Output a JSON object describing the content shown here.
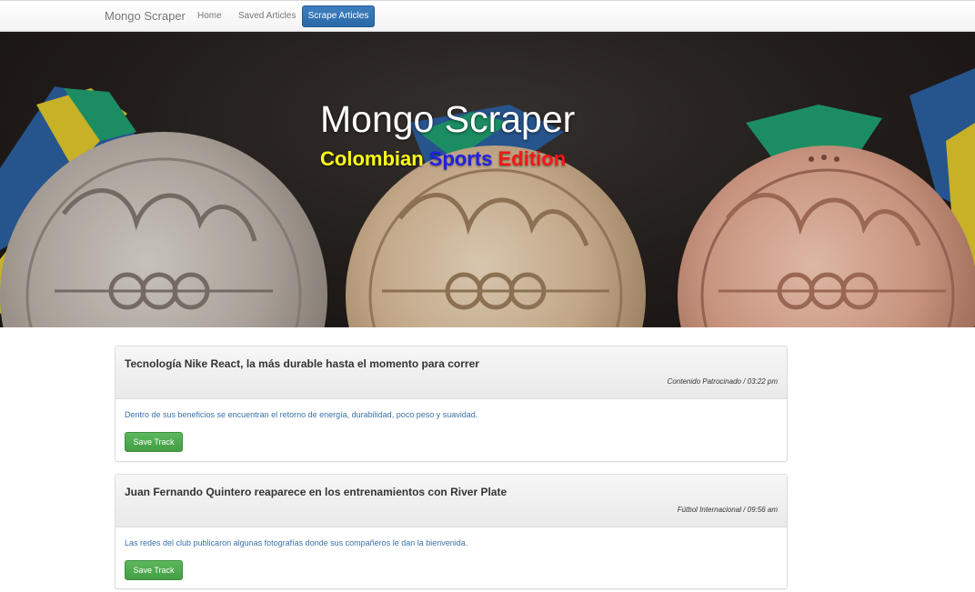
{
  "navbar": {
    "brand": "Mongo Scraper",
    "links": [
      {
        "label": "Home"
      },
      {
        "label": "Saved Articles"
      }
    ],
    "scrape_button": "Scrape Articles"
  },
  "hero": {
    "title": "Mongo Scraper",
    "subtitle_parts": [
      "Colombian",
      "Sports",
      "Edition"
    ],
    "colors": {
      "subtitle_yellow": "#ffff1a",
      "subtitle_blue": "#1f1fe8",
      "subtitle_red": "#ff1414"
    }
  },
  "articles": [
    {
      "title": "Tecnología Nike React, la más durable hasta el momento para correr",
      "meta": "Contenido Patrocinado / 03:22 pm",
      "summary": "Dentro de sus beneficios se encuentran el retorno de energía, durabilidad, poco peso y suavidad.",
      "button": "Save Track"
    },
    {
      "title": "Juan Fernando Quintero reaparece en los entrenamientos con River Plate",
      "meta": "Fútbol Internacional / 09:56 am",
      "summary": "Las redes del club publicaron algunas fotografías donde sus compañeros le dan la bienvenida.",
      "button": "Save Track"
    }
  ],
  "colors": {
    "primary": "#2b68a6",
    "success": "#449d44",
    "link": "#3a72a8"
  }
}
